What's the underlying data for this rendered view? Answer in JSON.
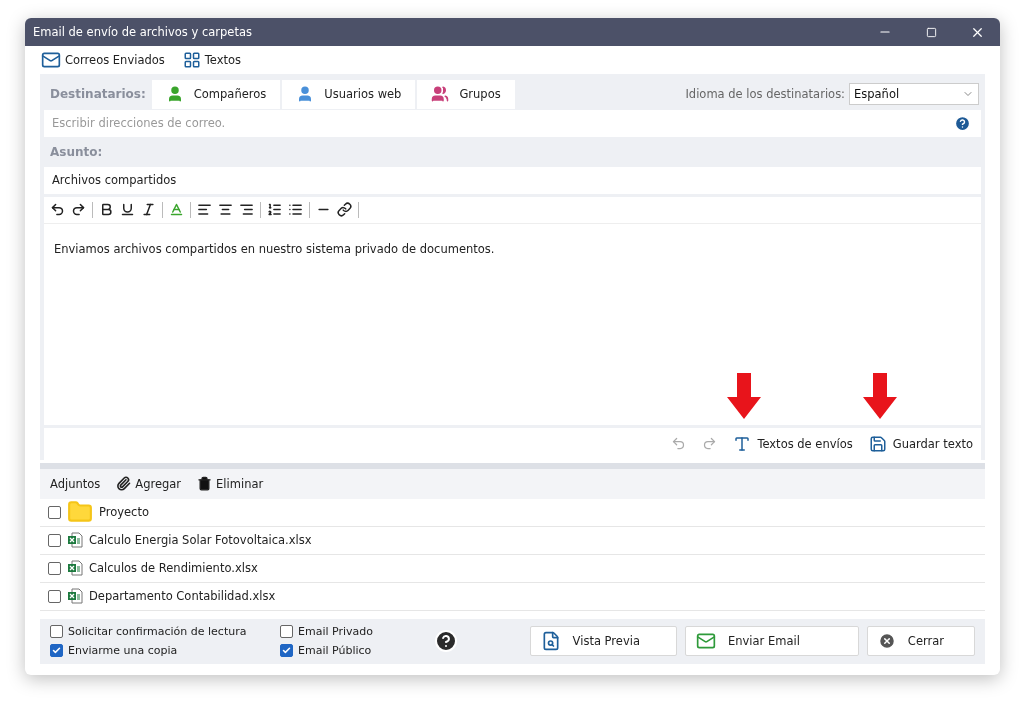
{
  "window": {
    "title": "Email de envío de archivos y carpetas"
  },
  "toolbar": [
    {
      "kind": "sent",
      "label": "Correos Enviados"
    },
    {
      "kind": "texts",
      "label": "Textos"
    }
  ],
  "recipients": {
    "label": "Destinatarios:",
    "tabs": [
      {
        "label": "Compañeros",
        "color": "#3aa52c"
      },
      {
        "label": "Usuarios web",
        "color": "#4a90d9"
      },
      {
        "label": "Grupos",
        "color": "#c8407a"
      }
    ],
    "language": {
      "label": "Idioma de los destinatarios:",
      "value": "Español"
    },
    "address": {
      "placeholder": "Escribir direcciones de correo."
    }
  },
  "subject": {
    "label": "Asunto:",
    "value": "Archivos compartidos"
  },
  "editor": {
    "body": "Enviamos archivos compartidos en nuestro sistema privado de documentos.",
    "footer_buttons": [
      {
        "kind": "text",
        "label": "Textos de envíos",
        "annotated": true
      },
      {
        "kind": "save",
        "label": "Guardar texto",
        "annotated": true
      }
    ]
  },
  "attachments": {
    "label": "Adjuntos",
    "actions": [
      {
        "kind": "add",
        "label": "Agregar"
      },
      {
        "kind": "delete",
        "label": "Eliminar"
      }
    ],
    "items": [
      {
        "kind": "folder",
        "name": "Proyecto",
        "checked": false
      },
      {
        "kind": "excel",
        "name": "Calculo Energia Solar Fotovoltaica.xlsx",
        "checked": false
      },
      {
        "kind": "excel",
        "name": "Calculos de Rendimiento.xlsx",
        "checked": false
      },
      {
        "kind": "excel",
        "name": "Departamento Contabilidad.xlsx",
        "checked": false
      }
    ]
  },
  "options": [
    {
      "label": "Solicitar confirmación de lectura",
      "checked": false
    },
    {
      "label": "Enviarme una copia",
      "checked": true
    },
    {
      "label": "Email Privado",
      "checked": false
    },
    {
      "label": "Email Público",
      "checked": true
    }
  ],
  "buttons": [
    {
      "kind": "preview",
      "label": "Vista Previa"
    },
    {
      "kind": "send",
      "label": "Enviar Email"
    },
    {
      "kind": "close",
      "label": "Cerrar"
    }
  ]
}
